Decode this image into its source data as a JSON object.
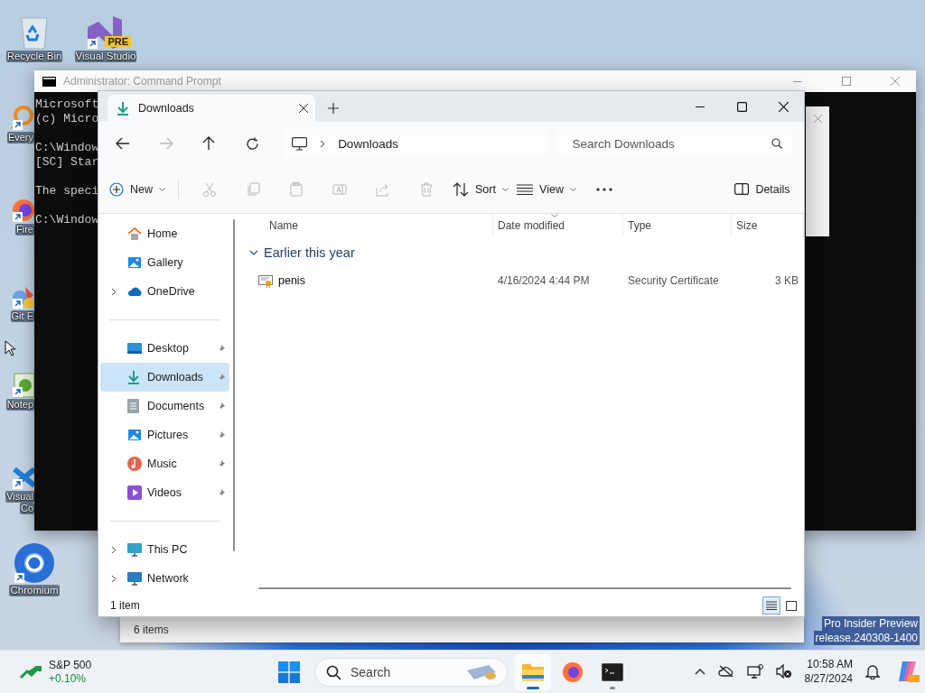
{
  "desktop_icons": [
    {
      "kind": "recycle-bin",
      "lines": [
        "Recycle Bin"
      ],
      "shortcut": false
    },
    {
      "kind": "visual-studio",
      "lines": [
        "Visual Studio"
      ],
      "shortcut": true,
      "badge": "PRE"
    },
    {
      "kind": "everything",
      "lines": [
        "Every"
      ],
      "shortcut": true
    },
    {
      "kind": "firefox",
      "lines": [
        "Fire"
      ],
      "shortcut": true
    },
    {
      "kind": "git",
      "lines": [
        "Git E"
      ],
      "shortcut": true
    },
    {
      "kind": "notepad",
      "lines": [
        "Notep"
      ],
      "shortcut": true
    },
    {
      "kind": "vscode",
      "lines": [
        "Visual",
        "Co"
      ],
      "shortcut": true
    },
    {
      "kind": "chromium",
      "lines": [
        "Chromium"
      ],
      "shortcut": true
    }
  ],
  "cmd_window": {
    "title": "Administrator: Command Prompt",
    "blocks": [
      [
        "Microsoft",
        "(c) Micro"
      ],
      [
        "C:\\Window",
        "[SC] Star"
      ],
      [
        "The speci"
      ],
      [
        "C:\\Window"
      ]
    ]
  },
  "explorer": {
    "tabs": [
      {
        "label": "Downloads",
        "selected": true
      }
    ],
    "nav_buttons": [
      {
        "kind": "back",
        "disabled": false
      },
      {
        "kind": "forward",
        "disabled": true
      },
      {
        "kind": "up",
        "disabled": false
      },
      {
        "kind": "refresh",
        "disabled": false
      }
    ],
    "breadcrumb": [
      "Downloads"
    ],
    "search": {
      "placeholder": "Search Downloads"
    },
    "toolbar": [
      {
        "kind": "new",
        "label": "New",
        "dropdown": true,
        "disabled": false
      },
      {
        "kind": "cut",
        "disabled": true
      },
      {
        "kind": "copy",
        "disabled": true
      },
      {
        "kind": "paste",
        "disabled": true
      },
      {
        "kind": "rename",
        "disabled": true
      },
      {
        "kind": "share",
        "disabled": true
      },
      {
        "kind": "delete",
        "disabled": true
      },
      {
        "kind": "sort",
        "label": "Sort",
        "dropdown": true,
        "disabled": false
      },
      {
        "kind": "view",
        "label": "View",
        "dropdown": true,
        "disabled": false
      },
      {
        "kind": "more",
        "disabled": false
      },
      {
        "kind": "details",
        "label": "Details",
        "disabled": false
      }
    ],
    "nav_groups": [
      [
        {
          "kind": "home",
          "label": "Home",
          "expandable": false,
          "pinned": false,
          "selected": false
        },
        {
          "kind": "gallery",
          "label": "Gallery",
          "expandable": false,
          "pinned": false,
          "selected": false
        },
        {
          "kind": "onedrive",
          "label": "OneDrive",
          "expandable": true,
          "pinned": false,
          "selected": false
        }
      ],
      [
        {
          "kind": "desktop",
          "label": "Desktop",
          "expandable": false,
          "pinned": true,
          "selected": false
        },
        {
          "kind": "downloads",
          "label": "Downloads",
          "expandable": false,
          "pinned": true,
          "selected": true
        },
        {
          "kind": "documents",
          "label": "Documents",
          "expandable": false,
          "pinned": true,
          "selected": false
        },
        {
          "kind": "pictures",
          "label": "Pictures",
          "expandable": false,
          "pinned": true,
          "selected": false
        },
        {
          "kind": "music",
          "label": "Music",
          "expandable": false,
          "pinned": true,
          "selected": false
        },
        {
          "kind": "videos",
          "label": "Videos",
          "expandable": false,
          "pinned": true,
          "selected": false
        }
      ],
      [
        {
          "kind": "this-pc",
          "label": "This PC",
          "expandable": true,
          "pinned": false,
          "selected": false
        },
        {
          "kind": "network",
          "label": "Network",
          "expandable": true,
          "pinned": false,
          "selected": false
        }
      ]
    ],
    "columns": [
      {
        "label": "Name",
        "sorted": false
      },
      {
        "label": "Date modified",
        "sorted": true
      },
      {
        "label": "Type",
        "sorted": false
      },
      {
        "label": "Size",
        "sorted": false
      }
    ],
    "groups": [
      {
        "title": "Earlier this year",
        "expanded": true,
        "files": [
          {
            "name": "penis",
            "date_modified": "4/16/2024 4:44 PM",
            "type": "Security Certificate",
            "size": "3 KB",
            "selected": false
          }
        ]
      }
    ],
    "status": "1 item",
    "view_modes": [
      {
        "kind": "details",
        "selected": true
      },
      {
        "kind": "tiles",
        "selected": false
      }
    ]
  },
  "background_window": {
    "status": "6 items"
  },
  "system_watermark": [
    "Pro Insider Preview",
    "release.240308-1400"
  ],
  "taskbar": {
    "widget": {
      "title": "S&P 500",
      "change": "+0.10%"
    },
    "search": {
      "label": "Search"
    },
    "apps": [
      {
        "kind": "file-explorer",
        "active": true,
        "running": true
      },
      {
        "kind": "firefox",
        "active": false,
        "running": false
      },
      {
        "kind": "terminal",
        "active": false,
        "running": true
      }
    ],
    "tray": [
      {
        "kind": "chevron"
      },
      {
        "kind": "onedrive-off"
      },
      {
        "kind": "network"
      },
      {
        "kind": "volume-muted"
      }
    ],
    "time": "10:58 AM",
    "date": "8/27/2024"
  }
}
